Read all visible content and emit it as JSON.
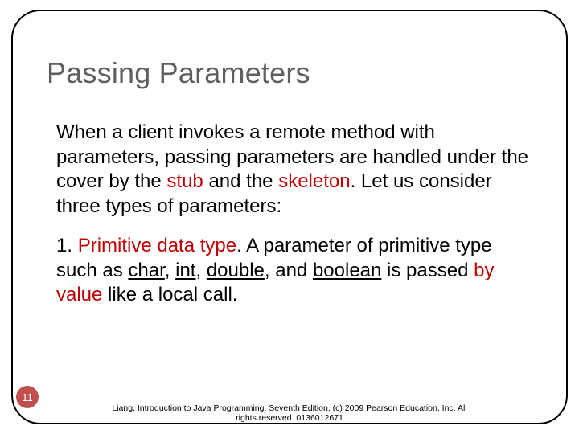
{
  "slide": {
    "title": "Passing Parameters",
    "para1": {
      "t1": "When a client invokes a remote method with parameters, passing parameters are handled under the cover by the ",
      "hl1": "stub",
      "t2": " and the ",
      "hl2": "skeleton",
      "t3": ". Let us consider three types of parameters:"
    },
    "para2": {
      "t1": "1. ",
      "hl1": "Primitive data type",
      "t2": ". A parameter of primitive type such as ",
      "u1": "char",
      "t3": ", ",
      "u2": "int",
      "t4": ", ",
      "u3": "double",
      "t5": ", and ",
      "u4": "boolean",
      "t6": " is passed ",
      "hl2": "by value",
      "t7": " like a local call."
    },
    "page_number": "11",
    "footer_line1": "Liang, Introduction to Java Programming, Seventh Edition, (c) 2009 Pearson Education, Inc. All",
    "footer_line2": "rights reserved. 0136012671"
  }
}
